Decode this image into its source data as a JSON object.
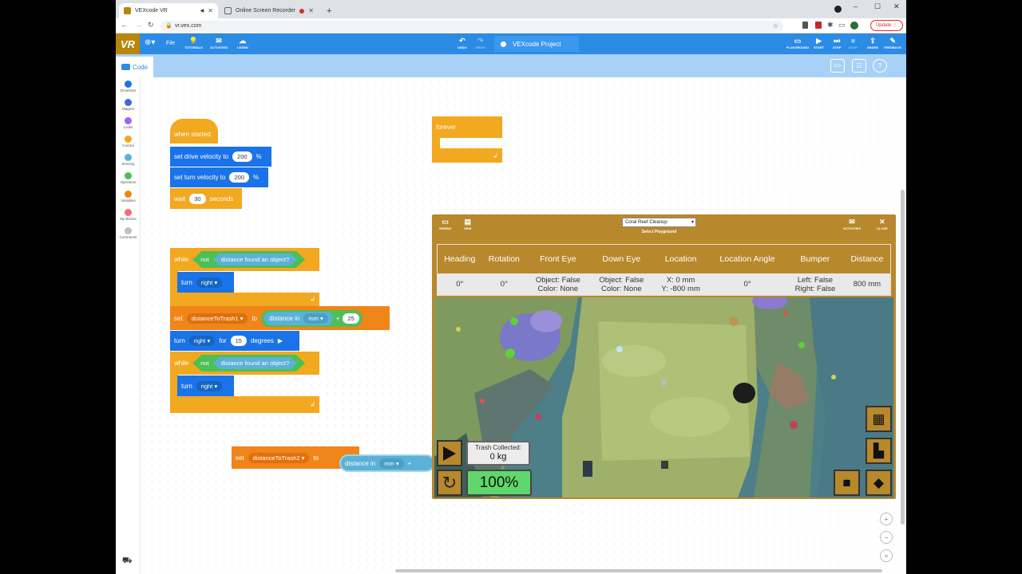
{
  "browser": {
    "tabs": [
      {
        "title": "VEXcode VR",
        "active": true
      },
      {
        "title": "Online Screen Recorder",
        "active": false
      }
    ],
    "new_tab": "+",
    "url": "vr.vex.com",
    "update_label": "Update"
  },
  "app": {
    "logo": "VR",
    "file_label": "File",
    "menu": {
      "tutorials": "TUTORIALS",
      "activities": "ACTIVITIES",
      "learn": "LEARN"
    },
    "edit": {
      "undo": "UNDO",
      "redo": "REDO"
    },
    "project_name": "VEXcode Project",
    "actions": {
      "playground": "PLAYGROUND",
      "start": "START",
      "step": "STEP",
      "stop": "STOP",
      "share": "SHARE",
      "feedback": "FEEDBACK"
    }
  },
  "code_tab": "Code",
  "categories": [
    {
      "label": "Drivetrain",
      "color": "#1a73e8"
    },
    {
      "label": "Magnet",
      "color": "#3d6ccc"
    },
    {
      "label": "Looks",
      "color": "#9966ff"
    },
    {
      "label": "Control",
      "color": "#f2a81f"
    },
    {
      "label": "Sensing",
      "color": "#5cb1d6"
    },
    {
      "label": "Operators",
      "color": "#4cbf56"
    },
    {
      "label": "Variables",
      "color": "#f08519"
    },
    {
      "label": "My Blocks",
      "color": "#ff6680"
    },
    {
      "label": "Comments",
      "color": "#c0c0c0"
    }
  ],
  "blocks": {
    "when_started": "when started",
    "set_drive_velocity": "set drive velocity to",
    "drive_velocity_value": "200",
    "set_turn_velocity": "set turn velocity to",
    "turn_velocity_value": "200",
    "percent": "%",
    "wait": "wait",
    "wait_value": "30",
    "seconds": "seconds",
    "forever": "forever",
    "while": "while",
    "not": "not",
    "distance_found": "distance found an object?",
    "turn": "turn",
    "right": "right",
    "set": "set",
    "var_trash1": "distanceToTrash1",
    "to": "to",
    "distance_in": "distance in",
    "mm": "mm",
    "plus": "+",
    "add_value": "25",
    "for": "for",
    "turn_degrees_value": "15",
    "degrees": "degrees",
    "var_trash2": "distanceToTrash2"
  },
  "sim": {
    "shrink": "SHRINK",
    "hide": "HIDE",
    "playground_value": "Coral Reef Cleanup",
    "select_playground": "Select Playground",
    "activities": "ACTIVITIES",
    "close": "CLOSE",
    "dashboard": {
      "headers": [
        "Heading",
        "Rotation",
        "Front Eye",
        "Down Eye",
        "Location",
        "Location Angle",
        "Bumper",
        "Distance"
      ],
      "heading": "0°",
      "rotation": "0°",
      "front_eye_1": "Object: False",
      "front_eye_2": "Color: None",
      "down_eye_1": "Object: False",
      "down_eye_2": "Color: None",
      "location_1": "X: 0 mm",
      "location_2": "Y: -800 mm",
      "location_angle": "0°",
      "bumper_1": "Left: False",
      "bumper_2": "Right: False",
      "distance": "800 mm"
    },
    "trash_label": "Trash Collected:",
    "trash_value": "0 kg",
    "speed": "100%"
  }
}
